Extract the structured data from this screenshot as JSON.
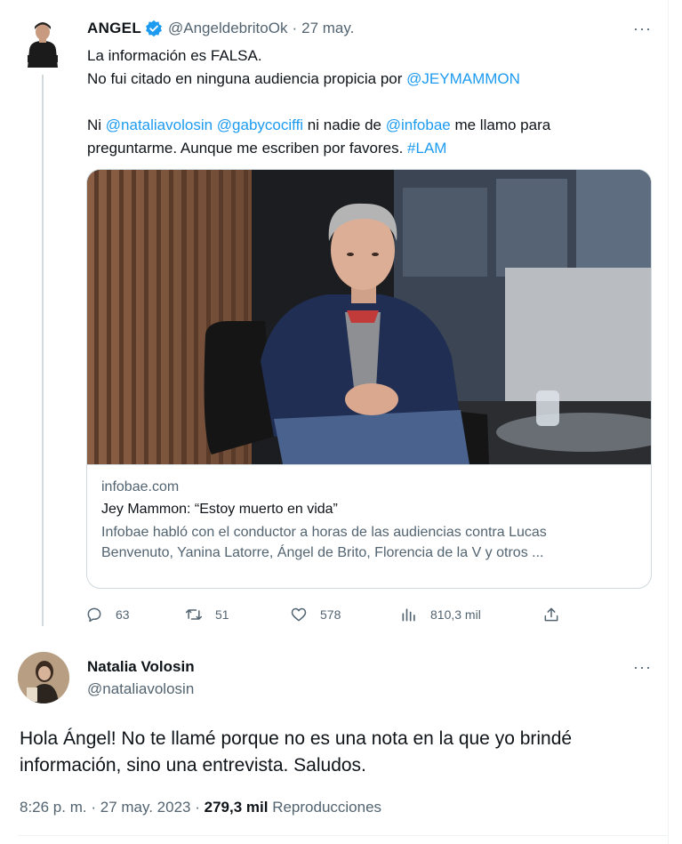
{
  "tweet1": {
    "name": "ANGEL",
    "handle": "@AngeldebritoOk",
    "separator": "·",
    "date": "27 may.",
    "more": "···",
    "lines": [
      {
        "parts": [
          {
            "text": "La información es FALSA.",
            "link": false
          }
        ]
      },
      {
        "parts": [
          {
            "text": "No fui citado en ninguna audiencia propicia por ",
            "link": false
          },
          {
            "text": "@JEYMAMMON",
            "link": true
          }
        ]
      },
      {
        "parts": []
      },
      {
        "parts": [
          {
            "text": "Ni ",
            "link": false
          },
          {
            "text": "@nataliavolosin",
            "link": true
          },
          {
            "text": " ",
            "link": false
          },
          {
            "text": "@gabycociffi",
            "link": true
          },
          {
            "text": " ni nadie de ",
            "link": false
          },
          {
            "text": "@infobae",
            "link": true
          },
          {
            "text": " me llamo para",
            "link": false
          }
        ]
      },
      {
        "parts": [
          {
            "text": "preguntarme. Aunque me escriben por favores.  ",
            "link": false
          },
          {
            "text": "#LAM",
            "link": true
          }
        ]
      }
    ],
    "card": {
      "domain": "infobae.com",
      "title": "Jey Mammon: “Estoy muerto en vida”",
      "description_line1": "Infobae habló con el conductor a horas de las audiencias contra Lucas",
      "description_line2": "Benvenuto, Yanina Latorre, Ángel de Brito, Florencia de la V y otros ..."
    },
    "actions": {
      "replies": "63",
      "retweets": "51",
      "likes": "578",
      "views": "810,3 mil"
    }
  },
  "tweet2": {
    "name": "Natalia Volosin",
    "handle": "@nataliavolosin",
    "more": "···",
    "text_line1": "Hola Ángel! No te llamé porque no es una nota en la que yo brindé",
    "text_line2": "información, sino una entrevista. Saludos.",
    "time": "8:26 p. m.",
    "date": "27 may. 2023",
    "views_count": "279,3 mil",
    "views_label": "Reproducciones"
  },
  "colors": {
    "link": "#1d9bf0",
    "secondary_text": "#536471",
    "primary_text": "#0f1419",
    "verified": "#1d9bf0",
    "border": "#cfd9de"
  }
}
